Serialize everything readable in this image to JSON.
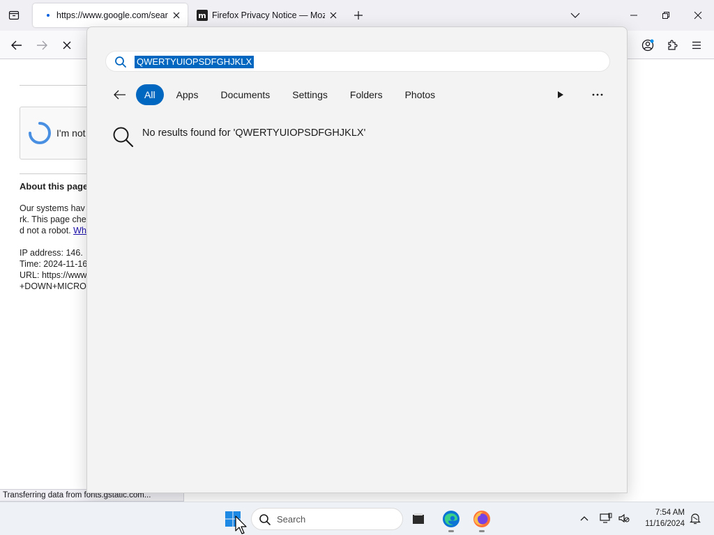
{
  "browser": {
    "tabs": [
      {
        "label": "https://www.google.com/search",
        "active": true
      },
      {
        "label": "Firefox Privacy Notice — Mozilla",
        "active": false,
        "favicon": "m"
      }
    ],
    "status_text": "Transferring data from fonts.gstatic.com..."
  },
  "page": {
    "captcha_text": "I'm not",
    "about_title": "About this page",
    "about_lines": [
      "Our systems hav",
      "rk. This page che",
      "d not a robot. "
    ],
    "about_link": "Wh",
    "ip_line": "IP address: 146.",
    "time_line": "Time: 2024-11-16",
    "url_line": "URL: https://www",
    "url_line2": "+DOWN+MICRO"
  },
  "search_flyout": {
    "query": "QWERTYUIOPSDFGHJKLX",
    "filters": [
      "All",
      "Apps",
      "Documents",
      "Settings",
      "Folders",
      "Photos"
    ],
    "active_filter": "All",
    "no_results_text": "No results found for 'QWERTYUIOPSDFGHJKLX'"
  },
  "taskbar": {
    "search_label": "Search",
    "time": "7:54 AM",
    "date": "11/16/2024"
  },
  "colors": {
    "accent": "#0067c0",
    "firefox_tab_dot": "#0060df"
  }
}
